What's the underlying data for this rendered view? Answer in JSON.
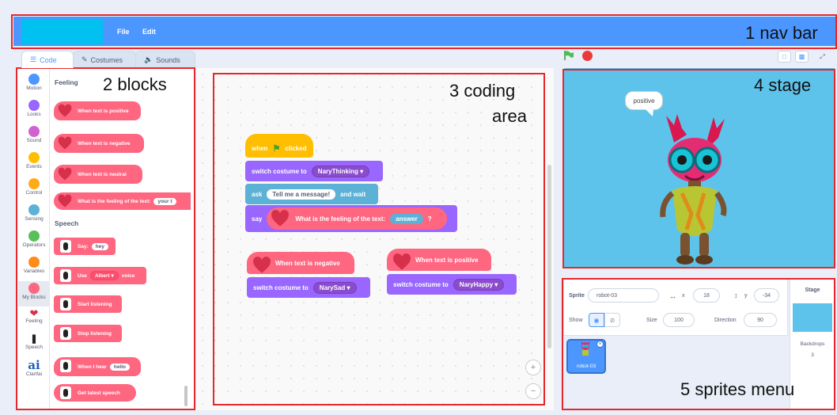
{
  "annotations": {
    "nav": "1 nav bar",
    "blocks": "2  blocks",
    "coding_line1": "3 coding",
    "coding_line2": "area",
    "stage": "4 stage",
    "sprites": "5 sprites menu"
  },
  "menu": {
    "file": "File",
    "edit": "Edit"
  },
  "tabs": [
    {
      "label": "Code",
      "icon": "code-icon"
    },
    {
      "label": "Costumes",
      "icon": "brush-icon"
    },
    {
      "label": "Sounds",
      "icon": "speaker-icon"
    }
  ],
  "categories": [
    {
      "label": "Motion",
      "color": "#4c97ff"
    },
    {
      "label": "Looks",
      "color": "#9966ff"
    },
    {
      "label": "Sound",
      "color": "#cf63cf"
    },
    {
      "label": "Events",
      "color": "#ffbf00"
    },
    {
      "label": "Control",
      "color": "#ffab19"
    },
    {
      "label": "Sensing",
      "color": "#5cb1d6"
    },
    {
      "label": "Operators",
      "color": "#59c059"
    },
    {
      "label": "Variables",
      "color": "#ff8c1a"
    },
    {
      "label": "My Blocks",
      "color": "#ff6680"
    },
    {
      "label": "Feeling",
      "color": "#d6304b"
    },
    {
      "label": "Speech",
      "color": "#222222"
    },
    {
      "label": "Clarifai",
      "color": "#1b5fb8"
    }
  ],
  "palette": {
    "feeling_heading": "Feeling",
    "feeling_blocks": [
      "When text is positive",
      "When text is negative",
      "When text is neutral"
    ],
    "feeling_reporter": {
      "text": "What is the feeling of the text:",
      "input": "your t"
    },
    "speech_heading": "Speech",
    "say": {
      "text": "Say:",
      "input": "hey"
    },
    "use_voice": {
      "pre": "Use",
      "voice": "Albert",
      "post": "voice"
    },
    "start_listening": "Start listening",
    "stop_listening": "Stop listening",
    "when_hear": {
      "text": "When I hear",
      "input": "hello"
    },
    "latest_speech": "Get latest speech"
  },
  "code": {
    "when_clicked_pre": "when",
    "when_clicked_post": "clicked",
    "switch_costume": "switch costume to",
    "costume1": "NaryThinking",
    "ask": "ask",
    "ask_input": "Tell me a message!",
    "and_wait": "and wait",
    "say": "say",
    "feeling_text": "What is the feeling of the text:",
    "answer": "answer",
    "question_mark": "?",
    "when_negative": "When text is negative",
    "costume_sad": "NarySad",
    "when_positive": "When text is positive",
    "costume_happy": "NaryHappy"
  },
  "stage": {
    "bubble": "positive"
  },
  "sprite_info": {
    "sprite_label": "Sprite",
    "sprite_name": "robot-03",
    "x_label": "x",
    "x": "18",
    "y_label": "y",
    "y": "-34",
    "show_label": "Show",
    "size_label": "Size",
    "size": "100",
    "direction_label": "Direction",
    "direction": "90",
    "thumb_name": "robot-03"
  },
  "stage_pane": {
    "title": "Stage",
    "backdrops_label": "Backdrops",
    "backdrops_count": "3"
  },
  "colors": {
    "nav": "#4c97ff",
    "accent_red": "#e8262b",
    "feeling_block": "#ff6680",
    "looks": "#9966ff",
    "events": "#ffbf00",
    "sensing": "#5cb1d6"
  }
}
